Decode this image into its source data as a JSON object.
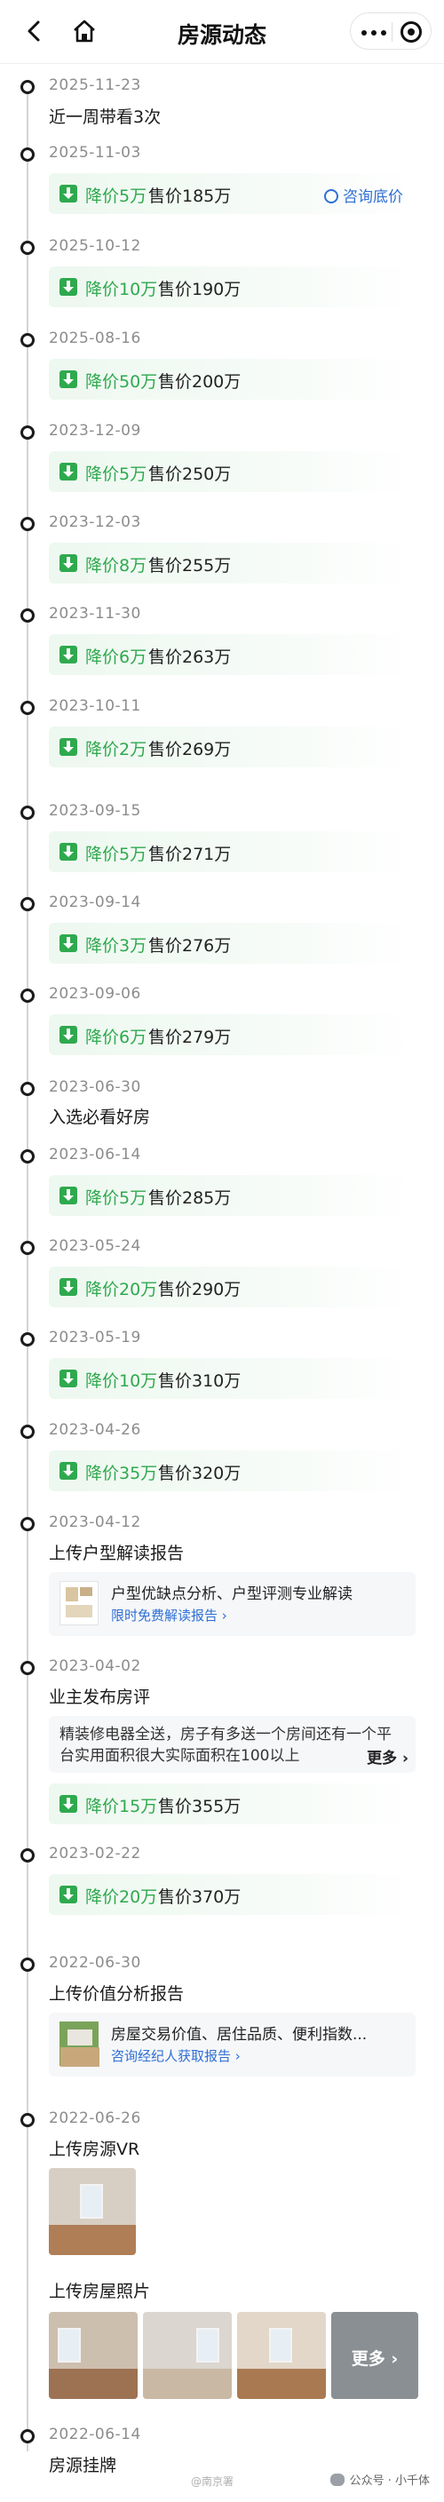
{
  "header": {
    "title": "房源动态",
    "back_icon": "chevron-left-icon",
    "home_icon": "home-icon",
    "more_icon": "more-dots-icon",
    "target_icon": "target-icon"
  },
  "colors": {
    "drop_green": "#2fa94e",
    "link_blue": "#2f6fd4"
  },
  "events": [
    {
      "date": "2025-11-23",
      "text": "近一周带看3次"
    },
    {
      "date": "2025-11-03",
      "drop": "降价5万",
      "price": "售价185万",
      "action": "咨询底价"
    },
    {
      "date": "2025-10-12",
      "drop": "降价10万",
      "price": "售价190万"
    },
    {
      "date": "2025-08-16",
      "drop": "降价50万",
      "price": "售价200万"
    },
    {
      "date": "2023-12-09",
      "drop": "降价5万",
      "price": "售价250万"
    },
    {
      "date": "2023-12-03",
      "drop": "降价8万",
      "price": "售价255万"
    },
    {
      "date": "2023-11-30",
      "drop": "降价6万",
      "price": "售价263万"
    },
    {
      "date": "2023-10-11",
      "drop": "降价2万",
      "price": "售价269万"
    },
    {
      "date": "2023-09-15",
      "drop": "降价5万",
      "price": "售价271万"
    },
    {
      "date": "2023-09-14",
      "drop": "降价3万",
      "price": "售价276万"
    },
    {
      "date": "2023-09-06",
      "drop": "降价6万",
      "price": "售价279万"
    },
    {
      "date": "2023-06-30",
      "text": "入选必看好房"
    },
    {
      "date": "2023-06-14",
      "drop": "降价5万",
      "price": "售价285万"
    },
    {
      "date": "2023-05-24",
      "drop": "降价20万",
      "price": "售价290万"
    },
    {
      "date": "2023-05-19",
      "drop": "降价10万",
      "price": "售价310万"
    },
    {
      "date": "2023-04-26",
      "drop": "降价35万",
      "price": "售价320万"
    },
    {
      "date": "2023-04-12",
      "text": "上传户型解读报告",
      "card_title": "户型优缺点分析、户型评测专业解读",
      "card_link": "限时免费解读报告 ›"
    },
    {
      "date": "2023-04-02",
      "text": "业主发布房评",
      "review": "精装修电器全送，房子有多送一个房间还有一个平台实用面积很大实际面积在100以上",
      "review_more": "更多 ›",
      "drop": "降价15万",
      "price": "售价355万"
    },
    {
      "date": "2023-02-22",
      "drop": "降价20万",
      "price": "售价370万"
    },
    {
      "date": "2022-06-30",
      "text": "上传价值分析报告",
      "card_title": "房屋交易价值、居住品质、便利指数...",
      "card_link": "咨询经纪人获取报告 ›"
    },
    {
      "date": "2022-06-26",
      "text": "上传房源VR",
      "text2": "上传房屋照片",
      "more_photos": "更多 ›"
    },
    {
      "date": "2022-06-14",
      "text": "房源挂牌"
    }
  ],
  "footer": {
    "watermark": "@南京署",
    "account_label": "公众号 · 小千体"
  }
}
